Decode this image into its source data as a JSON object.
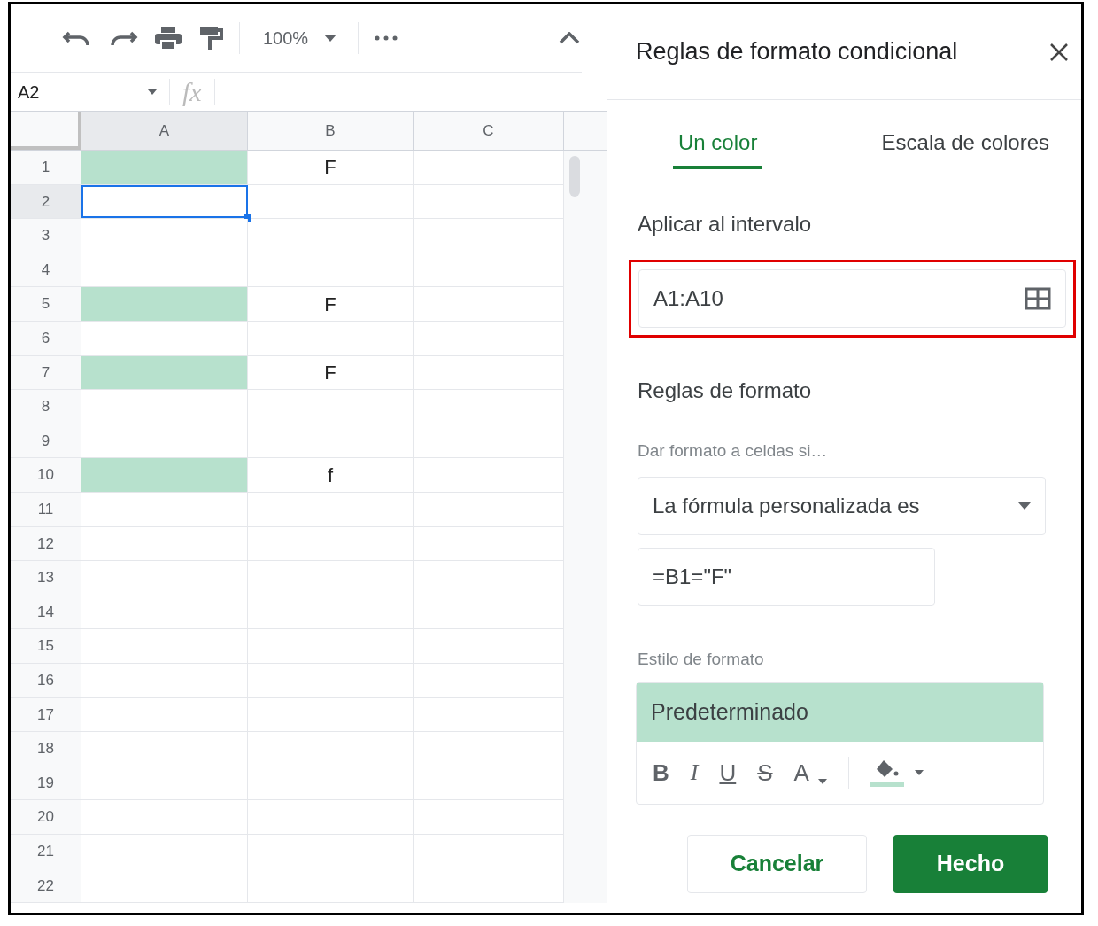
{
  "toolbar": {
    "zoom": "100%"
  },
  "formula_bar": {
    "cell_reference": "A2",
    "fx": "fx"
  },
  "columns": [
    {
      "label": "A",
      "selected": true
    },
    {
      "label": "B",
      "selected": false
    },
    {
      "label": "C",
      "selected": false
    }
  ],
  "rows": [
    {
      "number": "1",
      "selected": false,
      "a_highlighted": true,
      "a_selected": false,
      "b": "F"
    },
    {
      "number": "2",
      "selected": true,
      "a_highlighted": false,
      "a_selected": true,
      "b": ""
    },
    {
      "number": "3",
      "selected": false,
      "a_highlighted": false,
      "a_selected": false,
      "b": ""
    },
    {
      "number": "4",
      "selected": false,
      "a_highlighted": false,
      "a_selected": false,
      "b": ""
    },
    {
      "number": "5",
      "selected": false,
      "a_highlighted": true,
      "a_selected": false,
      "b": "F"
    },
    {
      "number": "6",
      "selected": false,
      "a_highlighted": false,
      "a_selected": false,
      "b": ""
    },
    {
      "number": "7",
      "selected": false,
      "a_highlighted": true,
      "a_selected": false,
      "b": "F"
    },
    {
      "number": "8",
      "selected": false,
      "a_highlighted": false,
      "a_selected": false,
      "b": ""
    },
    {
      "number": "9",
      "selected": false,
      "a_highlighted": false,
      "a_selected": false,
      "b": ""
    },
    {
      "number": "10",
      "selected": false,
      "a_highlighted": true,
      "a_selected": false,
      "b": "f"
    },
    {
      "number": "11",
      "selected": false,
      "a_highlighted": false,
      "a_selected": false,
      "b": ""
    },
    {
      "number": "12",
      "selected": false,
      "a_highlighted": false,
      "a_selected": false,
      "b": ""
    },
    {
      "number": "13",
      "selected": false,
      "a_highlighted": false,
      "a_selected": false,
      "b": ""
    },
    {
      "number": "14",
      "selected": false,
      "a_highlighted": false,
      "a_selected": false,
      "b": ""
    },
    {
      "number": "15",
      "selected": false,
      "a_highlighted": false,
      "a_selected": false,
      "b": ""
    },
    {
      "number": "16",
      "selected": false,
      "a_highlighted": false,
      "a_selected": false,
      "b": ""
    },
    {
      "number": "17",
      "selected": false,
      "a_highlighted": false,
      "a_selected": false,
      "b": ""
    },
    {
      "number": "18",
      "selected": false,
      "a_highlighted": false,
      "a_selected": false,
      "b": ""
    },
    {
      "number": "19",
      "selected": false,
      "a_highlighted": false,
      "a_selected": false,
      "b": ""
    },
    {
      "number": "20",
      "selected": false,
      "a_highlighted": false,
      "a_selected": false,
      "b": ""
    },
    {
      "number": "21",
      "selected": false,
      "a_highlighted": false,
      "a_selected": false,
      "b": ""
    },
    {
      "number": "22",
      "selected": false,
      "a_highlighted": false,
      "a_selected": false,
      "b": ""
    }
  ],
  "panel": {
    "title": "Reglas de formato condicional",
    "tabs": [
      {
        "label": "Un color",
        "selected": true
      },
      {
        "label": "Escala de colores",
        "selected": false
      }
    ],
    "range_heading": "Aplicar al intervalo",
    "range_field": {
      "value": "A1:A10",
      "highlighted": true
    },
    "rules_heading": "Reglas de formato",
    "condition_label": "Dar formato a celdas si…",
    "condition_dropdown": "La fórmula personalizada es",
    "formula_value": "=B1=\"F\"",
    "style_label": "Estilo de formato",
    "style_preview": "Predeterminado",
    "style_buttons": [
      {
        "label": "B",
        "kind": "bold"
      },
      {
        "label": "I",
        "kind": "italic"
      },
      {
        "label": "U",
        "kind": "underline"
      },
      {
        "label": "S",
        "kind": "strike"
      },
      {
        "label": "A",
        "kind": "text-color"
      },
      {
        "kind": "fill-color"
      }
    ],
    "buttons": [
      {
        "label": "Cancelar",
        "kind": "secondary"
      },
      {
        "label": "Hecho",
        "kind": "primary"
      }
    ]
  }
}
